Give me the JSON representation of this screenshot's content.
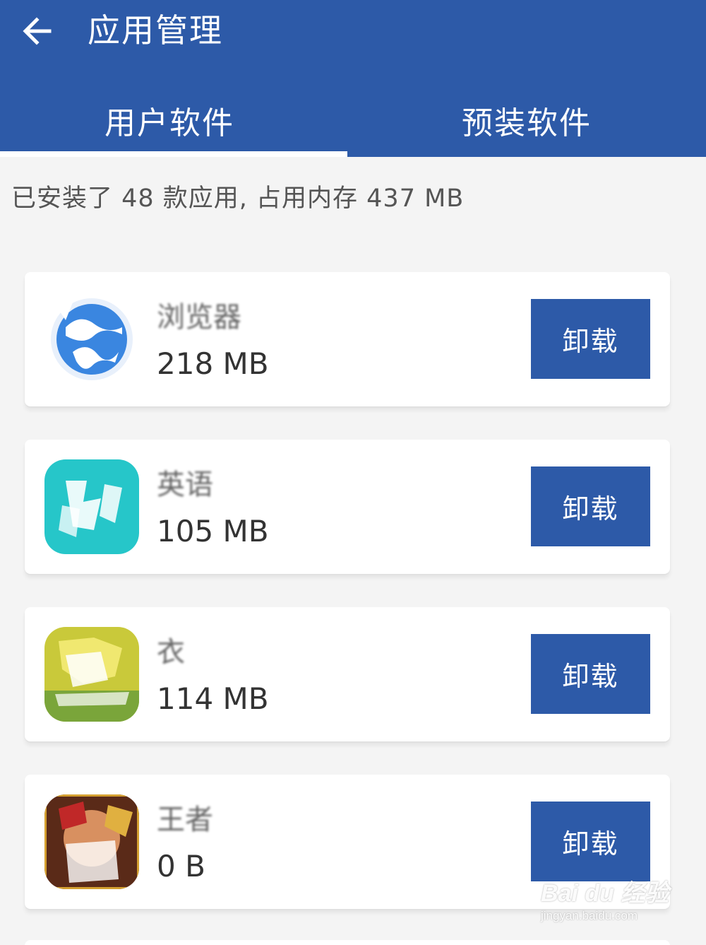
{
  "header": {
    "title": "应用管理",
    "back_icon": "arrow-left-icon",
    "colors": {
      "primary": "#2d5aa8",
      "text": "#ffffff"
    }
  },
  "tabs": [
    {
      "label": "用户软件",
      "selected": true
    },
    {
      "label": "预装软件",
      "selected": false
    }
  ],
  "summary": "已安装了 48 款应用, 占用内存 437 MB",
  "apps": [
    {
      "name": "浏览器",
      "size": "218 MB",
      "icon": "browser-globe-icon",
      "action_label": "卸载"
    },
    {
      "name": "英语",
      "size": "105 MB",
      "icon": "english-learning-icon",
      "action_label": "卸载"
    },
    {
      "name": "衣",
      "size": "114 MB",
      "icon": "game-app-icon",
      "action_label": "卸载"
    },
    {
      "name": "王者",
      "size": "0 B",
      "icon": "hero-game-icon",
      "action_label": "卸载"
    }
  ],
  "watermark": {
    "logo": "Bai du 经验",
    "url": "jingyan.baidu.com"
  }
}
